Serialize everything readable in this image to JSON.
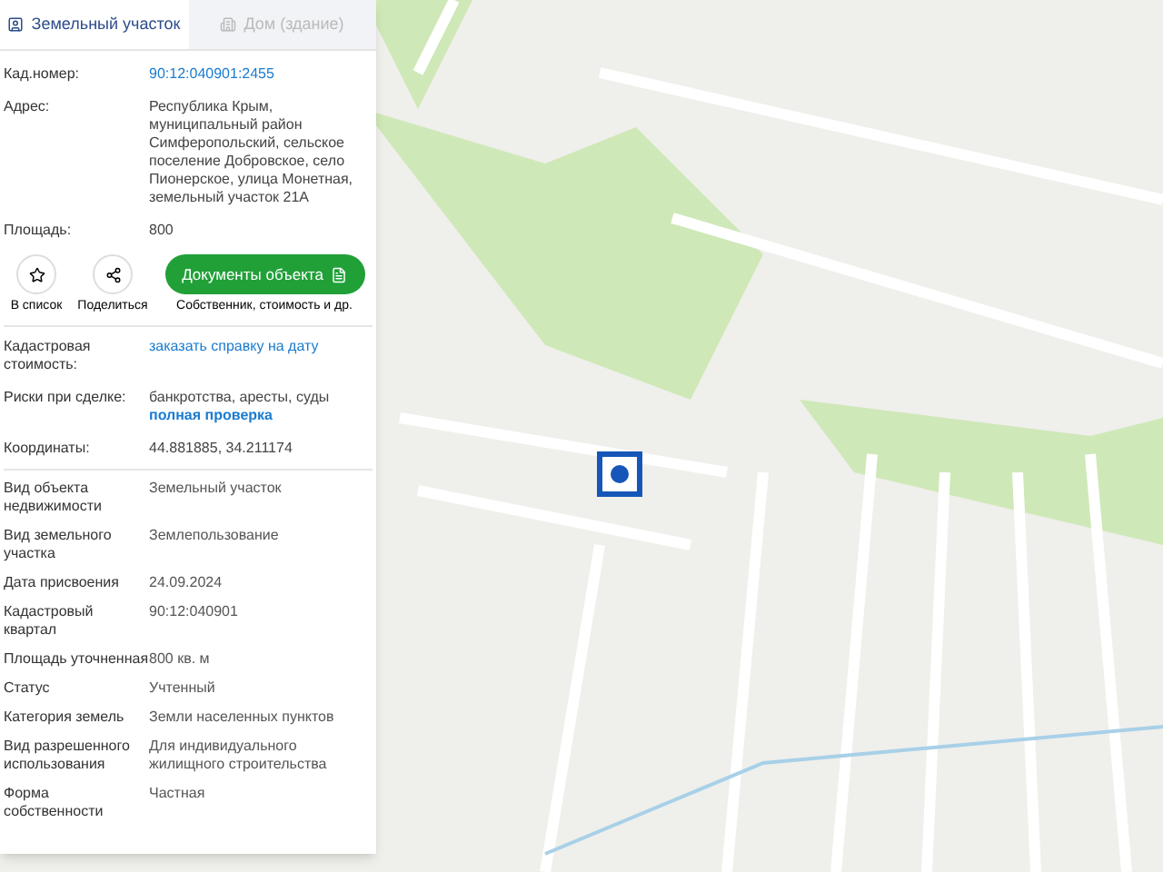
{
  "tabs": [
    {
      "label": "Земельный участок",
      "selected": true
    },
    {
      "label": "Дом (здание)",
      "selected": false
    }
  ],
  "main_fields": [
    {
      "label": "Кад.номер:",
      "value": "90:12:040901:2455",
      "kind": "link"
    },
    {
      "label": "Адрес:",
      "value": "Республика Крым, муниципальный район Симферопольский, сельское поселение Добровское, село Пионерское, улица Монетная, земельный участок 21А",
      "kind": "text"
    },
    {
      "label": "Площадь:",
      "value": "800",
      "kind": "text"
    }
  ],
  "actions": {
    "add_to_list": "В список",
    "share": "Поделиться",
    "documents_button": "Документы объекта",
    "documents_caption": "Собственник, стоимость и др."
  },
  "check_fields": [
    {
      "label": "Кадастровая стоимость:",
      "value": "заказать справку на дату",
      "kind": "link"
    },
    {
      "label": "Риски при сделке:",
      "value": "банкротства, аресты, суды",
      "link": "полная проверка",
      "kind": "text"
    },
    {
      "label": "Координаты:",
      "value": "44.881885, 34.211174",
      "kind": "text"
    }
  ],
  "details": [
    {
      "label": "Вид объекта недвижимости",
      "value": "Земельный участок"
    },
    {
      "label": "Вид земельного участка",
      "value": "Землепользование"
    },
    {
      "label": "Дата присвоения",
      "value": "24.09.2024"
    },
    {
      "label": "Кадастровый квартал",
      "value": "90:12:040901"
    },
    {
      "label": "Площадь уточненная",
      "value": "800 кв. м"
    },
    {
      "label": "Статус",
      "value": "Учтенный"
    },
    {
      "label": "Категория земель",
      "value": "Земли населенных пунктов"
    },
    {
      "label": "Вид разрешенного использования",
      "value": "Для индивидуального жилищного строительства"
    },
    {
      "label": "Форма собственности",
      "value": "Частная"
    }
  ]
}
